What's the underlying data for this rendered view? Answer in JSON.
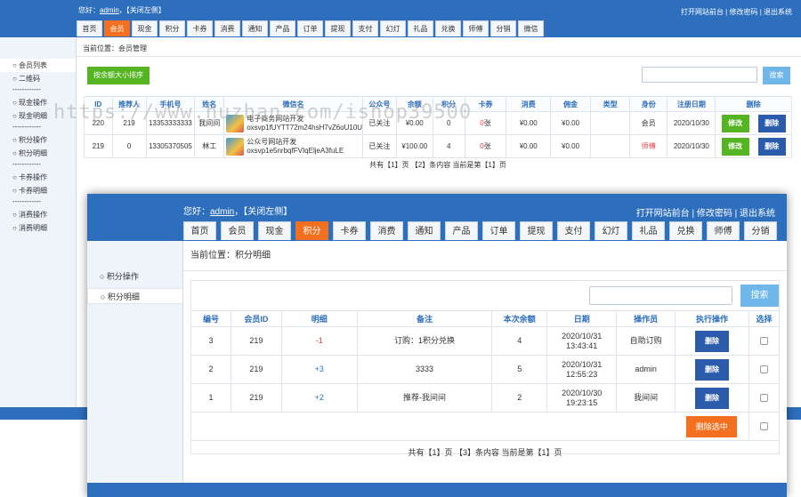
{
  "bg": {
    "greeting_prefix": "您好：",
    "user": "admin",
    "close_left": "，【关闭左侧】",
    "top_links": "打开网站前台 | 修改密码 | 退出系统",
    "nav": [
      "首页",
      "会员",
      "现金",
      "积分",
      "卡券",
      "消费",
      "通知",
      "产品",
      "订单",
      "提现",
      "支付",
      "幻灯",
      "礼品",
      "兑换",
      "师傅",
      "分销",
      "微信"
    ],
    "active_nav": "会员",
    "side": [
      {
        "type": "item",
        "label": "○ 会员列表",
        "on": true
      },
      {
        "type": "item",
        "label": "○ 二维码"
      },
      {
        "type": "sep",
        "label": "------------"
      },
      {
        "type": "item",
        "label": "○ 现金操作"
      },
      {
        "type": "item",
        "label": "○ 现金明细"
      },
      {
        "type": "sep",
        "label": "------------"
      },
      {
        "type": "item",
        "label": "○ 积分操作"
      },
      {
        "type": "item",
        "label": "○ 积分明细"
      },
      {
        "type": "sep",
        "label": "------------"
      },
      {
        "type": "item",
        "label": "○ 卡券操作"
      },
      {
        "type": "item",
        "label": "○ 卡券明细"
      },
      {
        "type": "sep",
        "label": "------------"
      },
      {
        "type": "item",
        "label": "○ 消费操作"
      },
      {
        "type": "item",
        "label": "○ 消费明细"
      }
    ],
    "crumb": "当前位置：会员管理",
    "green_button": "按余额大小排序",
    "search_button": "搜索",
    "columns": [
      "ID",
      "推荐人",
      "手机号",
      "姓名",
      "微信名",
      "公众号",
      "余额",
      "积分",
      "卡券",
      "消费",
      "佣金",
      "类型",
      "身份",
      "注册日期",
      "删除"
    ],
    "rows": [
      {
        "id": "220",
        "ref": "219",
        "phone": "13353333333",
        "name": "我间间",
        "nick1": "电子商务网站开发",
        "nick2": "oxsvp1fUYTT72m24hsH7vZ6oU10U",
        "mp": "已关注",
        "balance": "¥0.00",
        "points": "0",
        "cards_n": "0",
        "cards_u": "张",
        "spend": "¥0.00",
        "comm": "¥0.00",
        "type": "",
        "role": "会员",
        "role_red": false,
        "date": "2020/10/30",
        "edit": "修改",
        "del": "删除"
      },
      {
        "id": "219",
        "ref": "0",
        "phone": "13305370505",
        "name": "林工",
        "nick1": "公众号网站开发",
        "nick2": "oxsvp1e5nrbqfFVIqEljeA3fuLE",
        "mp": "已关注",
        "balance": "¥100.00",
        "points": "4",
        "cards_n": "0",
        "cards_u": "张",
        "spend": "¥0.00",
        "comm": "¥0.00",
        "type": "",
        "role": "师傅",
        "role_red": true,
        "date": "2020/10/30",
        "edit": "修改",
        "del": "删除"
      }
    ],
    "pager": "共有【1】页 【2】条内容 当前是第【1】页"
  },
  "watermark": "https://www.huzhan.com/ishop39500",
  "fg": {
    "greeting_prefix": "您好：",
    "user": "admin",
    "close_left": "，【关闭左侧】",
    "top_links": "打开网站前台 | 修改密码 | 退出系统",
    "nav": [
      "首页",
      "会员",
      "现金",
      "积分",
      "卡券",
      "消费",
      "通知",
      "产品",
      "订单",
      "提现",
      "支付",
      "幻灯",
      "礼品",
      "兑换",
      "师傅",
      "分销"
    ],
    "active_nav": "积分",
    "side": [
      {
        "label": "○ 积分操作"
      },
      {
        "label": "○ 积分明细",
        "on": true
      }
    ],
    "crumb": "当前位置：积分明细",
    "search_button": "搜索",
    "columns": [
      "编号",
      "会员ID",
      "明细",
      "备注",
      "本次余额",
      "日期",
      "操作员",
      "执行操作",
      "选择"
    ],
    "rows": [
      {
        "no": "3",
        "member": "219",
        "detail": "-1",
        "detail_color": "red",
        "note": "订购：1积分兑换",
        "bal": "4",
        "date1": "2020/10/31",
        "date2": "13:43:41",
        "op": "自助订购",
        "action": "删除"
      },
      {
        "no": "2",
        "member": "219",
        "detail": "+3",
        "detail_color": "blue",
        "note": "3333",
        "bal": "5",
        "date1": "2020/10/31",
        "date2": "12:55:23",
        "op": "admin",
        "action": "删除"
      },
      {
        "no": "1",
        "member": "219",
        "detail": "+2",
        "detail_color": "blue",
        "note": "推荐-我间间",
        "bal": "2",
        "date1": "2020/10/30",
        "date2": "19:23:15",
        "op": "我间间",
        "action": "删除"
      }
    ],
    "delete_selected": "删除选中",
    "pager": "共有【1】页 【3】条内容   当前是第【1】页"
  }
}
